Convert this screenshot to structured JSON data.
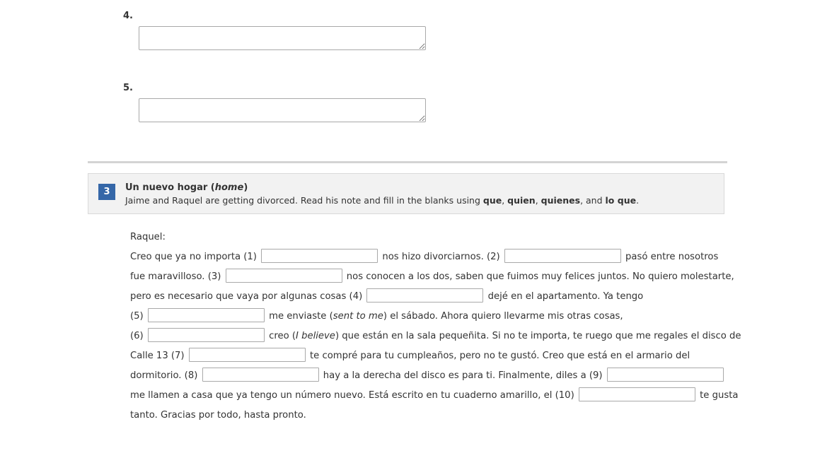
{
  "questions": [
    {
      "number": "4."
    },
    {
      "number": "5."
    }
  ],
  "activity": {
    "number": "3",
    "title_main": "Un nuevo hogar (",
    "title_italic": "home",
    "title_end": ")",
    "instructions": {
      "text1": "Jaime and Raquel are getting divorced. Read his note and fill in the blanks using ",
      "bold1": "que",
      "sep1": ", ",
      "bold2": "quien",
      "sep2": ", ",
      "bold3": "quienes",
      "sep3": ", and ",
      "bold4": "lo que",
      "end": "."
    }
  },
  "letter": {
    "greeting": "Raquel:",
    "l2a": "Creo que ya no importa (1)",
    "l2b": "nos hizo divorciarnos. (2)",
    "l2c": "pasó entre nosotros",
    "l3a": "fue maravilloso. (3)",
    "l3b": "nos conocen a los dos, saben que fuimos muy felices juntos. No quiero molestarte,",
    "l4a": "pero es necesario que vaya por algunas cosas (4)",
    "l4b": "dejé en el apartamento. Ya tengo",
    "l5a": "(5)",
    "l5b": "me enviaste (",
    "l5c": "sent to me",
    "l5d": ") el sábado. Ahora quiero llevarme mis otras cosas,",
    "l6a": "(6)",
    "l6b": "creo (",
    "l6c": "I believe",
    "l6d": ") que están en la sala pequeñita. Si no te importa, te ruego que me regales el disco de",
    "l7a": "Calle 13 (7)",
    "l7b": "te compré para tu cumpleaños, pero no te gustó. Creo que está en el armario del",
    "l8a": "dormitorio. (8)",
    "l8b": "hay a la derecha del disco es para ti. Finalmente, diles a (9)",
    "l9a": "me llamen a casa que ya tengo un número nuevo. Está escrito en tu cuaderno amarillo, el (10)",
    "l9b": "te gusta",
    "l10": "tanto. Gracias por todo, hasta pronto."
  },
  "blanks": [
    "",
    "",
    "",
    "",
    "",
    "",
    "",
    "",
    "",
    ""
  ]
}
